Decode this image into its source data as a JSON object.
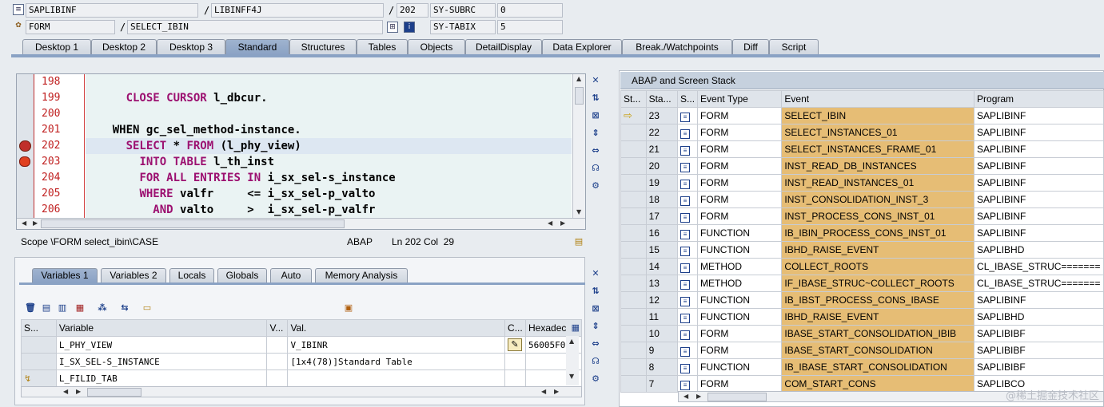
{
  "top": {
    "row1": {
      "f1": "SAPLIBINF",
      "f2": "LIBINFF4J",
      "f3": "202",
      "f4": "SY-SUBRC",
      "f5": "0"
    },
    "row2": {
      "f1": "FORM",
      "f2": "SELECT_IBIN",
      "f4": "SY-TABIX",
      "f5": "5"
    },
    "slash": "/"
  },
  "tabs": [
    "Desktop 1",
    "Desktop 2",
    "Desktop 3",
    "Standard",
    "Structures",
    "Tables",
    "Objects",
    "DetailDisplay",
    "Data Explorer",
    "Break./Watchpoints",
    "Diff",
    "Script"
  ],
  "editor": {
    "line_numbers": [
      "198",
      "199",
      "200",
      "201",
      "202",
      "203",
      "204",
      "205",
      "206"
    ],
    "status_scope": "Scope \\FORM select_ibin\\CASE",
    "status_lang": "ABAP",
    "status_pos": "Ln 202 Col  29"
  },
  "var_tabs": [
    "Variables 1",
    "Variables 2",
    "Locals",
    "Globals",
    "Auto",
    "Memory Analysis"
  ],
  "var_table": {
    "headers": [
      "S...",
      "Variable",
      "V...",
      "Val.",
      "C...",
      "Hexadec"
    ],
    "rows": [
      {
        "variable": "L_PHY_VIEW",
        "value": "V_IBINR",
        "hex": "56005F0"
      },
      {
        "variable": "I_SX_SEL-S_INSTANCE",
        "value": "[1x4(78)]Standard Table",
        "hex": ""
      },
      {
        "variable": "L_FILID_TAB",
        "value": "",
        "hex": ""
      }
    ]
  },
  "stack": {
    "title": "ABAP and Screen Stack",
    "headers": [
      "St...",
      "Sta...",
      "S...",
      "Event Type",
      "Event",
      "Program"
    ],
    "rows": [
      {
        "level": "23",
        "type": "FORM",
        "event": "SELECT_IBIN",
        "program": "SAPLIBINF"
      },
      {
        "level": "22",
        "type": "FORM",
        "event": "SELECT_INSTANCES_01",
        "program": "SAPLIBINF"
      },
      {
        "level": "21",
        "type": "FORM",
        "event": "SELECT_INSTANCES_FRAME_01",
        "program": "SAPLIBINF"
      },
      {
        "level": "20",
        "type": "FORM",
        "event": "INST_READ_DB_INSTANCES",
        "program": "SAPLIBINF"
      },
      {
        "level": "19",
        "type": "FORM",
        "event": "INST_READ_INSTANCES_01",
        "program": "SAPLIBINF"
      },
      {
        "level": "18",
        "type": "FORM",
        "event": "INST_CONSOLIDATION_INST_3",
        "program": "SAPLIBINF"
      },
      {
        "level": "17",
        "type": "FORM",
        "event": "INST_PROCESS_CONS_INST_01",
        "program": "SAPLIBINF"
      },
      {
        "level": "16",
        "type": "FUNCTION",
        "event": "IB_IBIN_PROCESS_CONS_INST_01",
        "program": "SAPLIBINF"
      },
      {
        "level": "15",
        "type": "FUNCTION",
        "event": "IBHD_RAISE_EVENT",
        "program": "SAPLIBHD"
      },
      {
        "level": "14",
        "type": "METHOD",
        "event": "COLLECT_ROOTS",
        "program": "CL_IBASE_STRUC======="
      },
      {
        "level": "13",
        "type": "METHOD",
        "event": "IF_IBASE_STRUC~COLLECT_ROOTS",
        "program": "CL_IBASE_STRUC======="
      },
      {
        "level": "12",
        "type": "FUNCTION",
        "event": "IB_IBST_PROCESS_CONS_IBASE",
        "program": "SAPLIBINF"
      },
      {
        "level": "11",
        "type": "FUNCTION",
        "event": "IBHD_RAISE_EVENT",
        "program": "SAPLIBHD"
      },
      {
        "level": "10",
        "type": "FORM",
        "event": "IBASE_START_CONSOLIDATION_IBIB",
        "program": "SAPLIBIBF"
      },
      {
        "level": "9",
        "type": "FORM",
        "event": "IBASE_START_CONSOLIDATION",
        "program": "SAPLIBIBF"
      },
      {
        "level": "8",
        "type": "FUNCTION",
        "event": "IB_IBASE_START_CONSOLIDATION",
        "program": "SAPLIBIBF"
      },
      {
        "level": "7",
        "type": "FORM",
        "event": "COM_START_CONS",
        "program": "SAPLIBCO"
      }
    ]
  },
  "watermark": "@稀土掘金技术社区",
  "colors": {
    "keyword": "#9c1070",
    "event_bg": "#e6bd75",
    "active_tab": "#8aa2c4"
  }
}
